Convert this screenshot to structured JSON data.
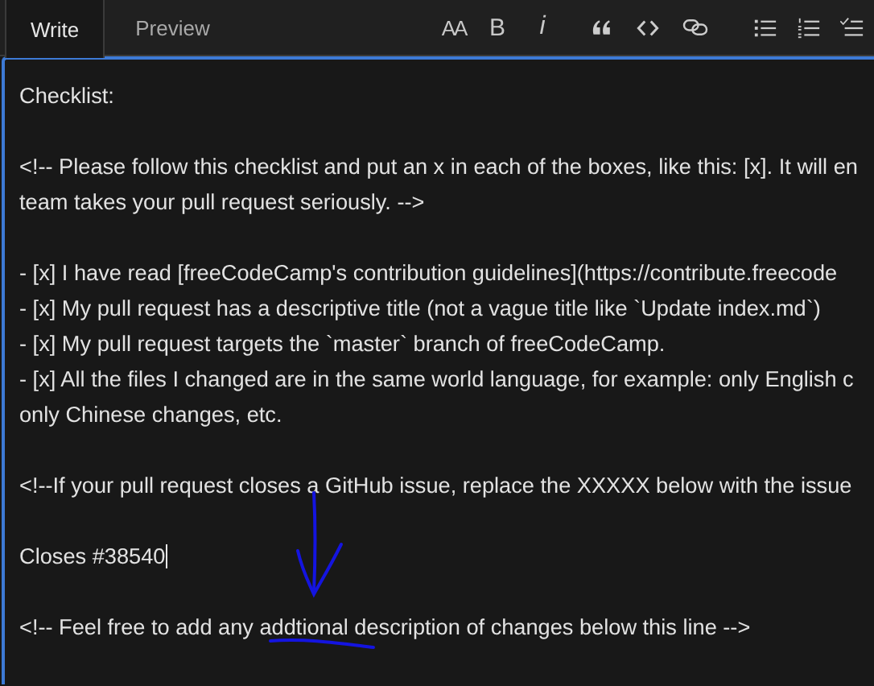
{
  "tabs": [
    {
      "label": "Write",
      "selected": true
    },
    {
      "label": "Preview",
      "selected": false
    }
  ],
  "toolbar": [
    {
      "kind": "heading",
      "label": "AA"
    },
    {
      "kind": "bold",
      "label": "B"
    },
    {
      "kind": "italic",
      "label": "i"
    },
    {
      "kind": "quote"
    },
    {
      "kind": "code"
    },
    {
      "kind": "link"
    },
    {
      "kind": "bullets"
    },
    {
      "kind": "numbers"
    },
    {
      "kind": "tasks"
    }
  ],
  "editor": {
    "blocks": [
      {
        "lines": [
          {
            "text": "Checklist:",
            "caret": false
          }
        ]
      },
      {
        "lines": [
          {
            "text": "<!-- Please follow this checklist and put an x in each of the boxes, like this: [x]. It will en",
            "caret": false
          },
          {
            "text": "team takes your pull request seriously. -->",
            "caret": false
          }
        ]
      },
      {
        "lines": [
          {
            "text": "- [x] I have read [freeCodeCamp's contribution guidelines](https://contribute.freecode",
            "caret": false
          },
          {
            "text": "- [x] My pull request has a descriptive title (not a vague title like `Update index.md`)",
            "caret": false
          },
          {
            "text": "- [x] My pull request targets the `master` branch of freeCodeCamp.",
            "caret": false
          },
          {
            "text": "- [x] All the files I changed are in the same world language, for example: only English c",
            "caret": false
          },
          {
            "text": "only Chinese changes, etc.",
            "caret": false
          }
        ]
      },
      {
        "lines": [
          {
            "text": "<!--If your pull request closes a GitHub issue, replace the XXXXX below with the issue",
            "caret": false
          }
        ]
      },
      {
        "lines": [
          {
            "text": "Closes #38540",
            "caret": true
          }
        ]
      },
      {
        "lines": [
          {
            "text": "<!-- Feel free to add any addtional description of changes below this line -->",
            "caret": false
          }
        ]
      }
    ]
  }
}
